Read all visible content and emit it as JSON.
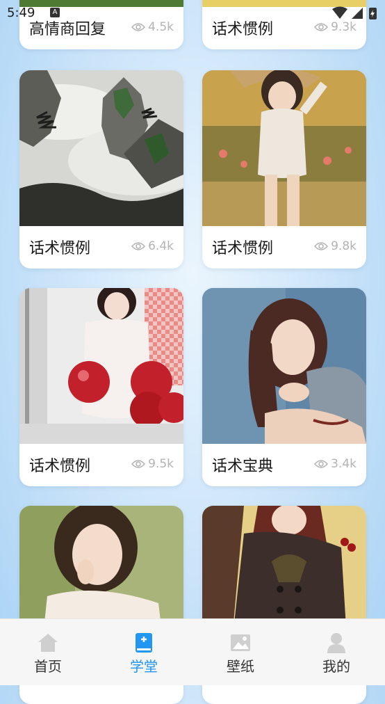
{
  "status_bar": {
    "time": "5:49",
    "notification": "A"
  },
  "cards": [
    {
      "title": "高情商回复",
      "views": "4.5k",
      "image": "green-top-image"
    },
    {
      "title": "话术惯例",
      "views": "9.3k",
      "image": "yellow-top-image"
    },
    {
      "title": "话术惯例",
      "views": "6.4k",
      "image": "ink-landscape-painting"
    },
    {
      "title": "话术惯例",
      "views": "9.8k",
      "image": "anime-girl-in-field"
    },
    {
      "title": "话术惯例",
      "views": "9.5k",
      "image": "girl-with-red-balloons"
    },
    {
      "title": "话术宝典",
      "views": "3.4k",
      "image": "girl-thinking-blue-background"
    },
    {
      "title": "",
      "views": "",
      "image": "girl-portrait-green-background"
    },
    {
      "title": "",
      "views": "",
      "image": "anime-character-dark-outfit"
    }
  ],
  "nav": [
    {
      "label": "首页",
      "icon": "home-icon",
      "active": false
    },
    {
      "label": "学堂",
      "icon": "book-icon",
      "active": true
    },
    {
      "label": "壁纸",
      "icon": "image-icon",
      "active": false
    },
    {
      "label": "我的",
      "icon": "user-icon",
      "active": false
    }
  ],
  "colors": {
    "accent": "#2196f3",
    "inactive_icon": "#cfcfcf"
  }
}
